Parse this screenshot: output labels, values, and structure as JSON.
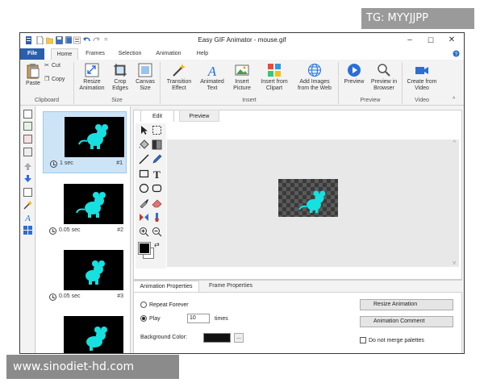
{
  "window": {
    "title": "Easy GIF Animator - mouse.gif",
    "controls": {
      "minimize": "–",
      "maximize": "☐",
      "close": "✕"
    }
  },
  "menu_tabs": [
    "File",
    "Home",
    "Frames",
    "Selection",
    "Animation",
    "Help"
  ],
  "ribbon": {
    "clipboard": {
      "paste": "Paste",
      "cut": "Cut",
      "copy": "Copy",
      "label": "Clipboard"
    },
    "size": {
      "resize": "Resize Animation",
      "crop": "Crop Edges",
      "canvas": "Canvas Size",
      "label": "Size"
    },
    "insert": {
      "transition": "Transition Effect",
      "animated_text": "Animated Text",
      "picture": "Insert Picture",
      "clipart": "Insert from Clipart",
      "web": "Add Images from the Web",
      "label": "Insert"
    },
    "preview": {
      "preview": "Preview",
      "browser": "Preview in Browser",
      "label": "Preview"
    },
    "video": {
      "create": "Create from Video",
      "label": "Video"
    }
  },
  "frames": [
    {
      "delay": "1 sec",
      "number": "#1"
    },
    {
      "delay": "0.05 sec",
      "number": "#2"
    },
    {
      "delay": "0.05 sec",
      "number": "#3"
    },
    {
      "delay": "",
      "number": ""
    }
  ],
  "editor": {
    "tabs": [
      "Edit",
      "Preview"
    ]
  },
  "properties": {
    "tabs": [
      "Animation Properties",
      "Frame Properties"
    ],
    "repeat_forever": "Repeat Forever",
    "play": "Play",
    "play_times": "10",
    "times": "times",
    "background_color_label": "Background Color:",
    "background_color": "#111111",
    "browse": "...",
    "resize_animation": "Resize Animation",
    "animation_comment": "Animation Comment",
    "do_not_merge": "Do not merge palettes"
  },
  "watermarks": {
    "top": "TG: MYYJJPP",
    "bottom": "www.sinodiet-hd.com"
  },
  "colors": {
    "accent": "#2b5fae",
    "mouse": "#17e0e0",
    "selection": "#cde4f7"
  }
}
